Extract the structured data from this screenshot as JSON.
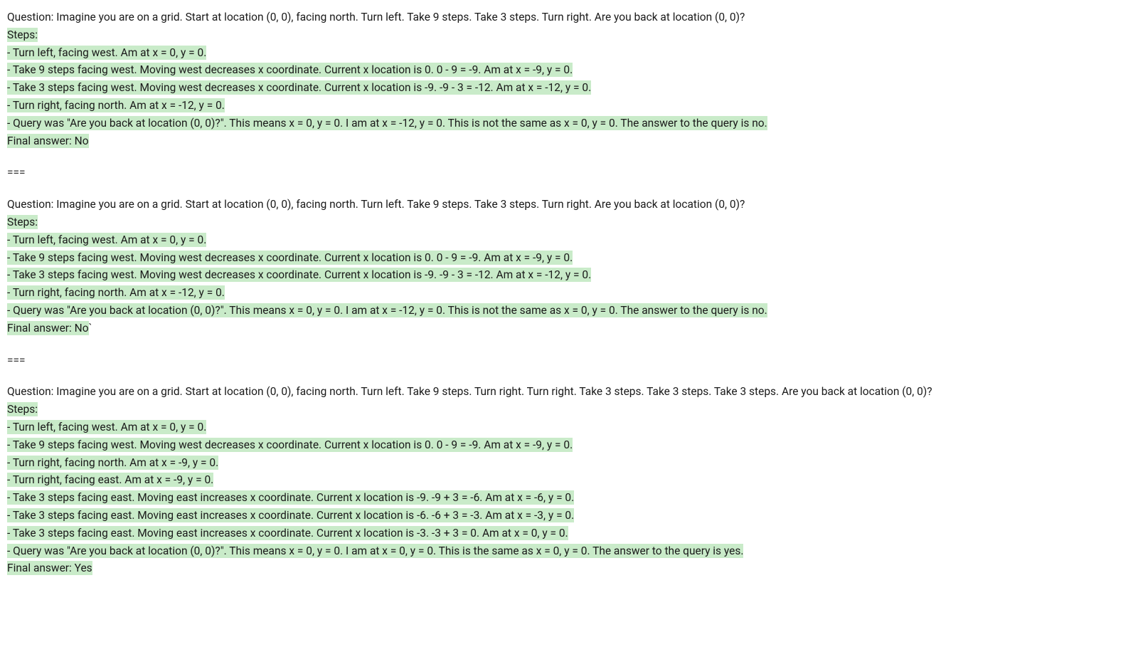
{
  "separator": "===",
  "examples": [
    {
      "question": "Question: Imagine you are on a grid. Start at location (0, 0), facing north. Turn left. Take 9 steps. Take 3 steps. Turn right. Are you back at location (0, 0)?",
      "steps_label": "Steps:",
      "steps": [
        "- Turn left, facing west. Am at x = 0, y = 0.",
        "- Take 9 steps facing west. Moving west decreases x coordinate. Current x location is 0. 0 - 9 = -9. Am at x = -9, y = 0.",
        "- Take 3 steps facing west. Moving west decreases x coordinate. Current x location is -9. -9 - 3 = -12. Am at x = -12, y = 0.",
        "- Turn right, facing north. Am at x = -12, y = 0.",
        "- Query was \"Are you back at location (0, 0)?\". This means x = 0, y = 0. I am at x = -12, y = 0. This is not the same as x = 0, y = 0. The answer to the query is no."
      ],
      "final_answer": "Final answer: No",
      "trailing": ""
    },
    {
      "question": "Question: Imagine you are on a grid. Start at location (0, 0), facing north. Turn left. Take 9 steps. Take 3 steps. Turn right. Are you back at location (0, 0)?",
      "steps_label": "Steps:",
      "steps": [
        "- Turn left, facing west. Am at x = 0, y = 0.",
        "- Take 9 steps facing west. Moving west decreases x coordinate. Current x location is 0. 0 - 9 = -9. Am at x = -9, y = 0.",
        "- Take 3 steps facing west. Moving west decreases x coordinate. Current x location is -9. -9 - 3 = -12. Am at x = -12, y = 0.",
        "- Turn right, facing north. Am at x = -12, y = 0.",
        "- Query was \"Are you back at location (0, 0)?\". This means x = 0, y = 0. I am at x = -12, y = 0. This is not the same as x = 0, y = 0. The answer to the query is no."
      ],
      "final_answer": "Final answer: No",
      "trailing": "`"
    },
    {
      "question": "Question: Imagine you are on a grid. Start at location (0, 0), facing north. Turn left. Take 9 steps. Turn right. Turn right. Take 3 steps. Take 3 steps. Take 3 steps. Are you back at location (0, 0)?",
      "steps_label": "Steps:",
      "steps": [
        "- Turn left, facing west. Am at x = 0, y = 0.",
        "- Take 9 steps facing west. Moving west decreases x coordinate. Current x location is 0. 0 - 9 = -9. Am at x = -9, y = 0.",
        "- Turn right, facing north. Am at x = -9, y = 0.",
        "- Turn right, facing east. Am at x = -9, y = 0.",
        "- Take 3 steps facing east. Moving east increases x coordinate. Current x location is -9. -9 + 3 = -6. Am at x = -6, y = 0.",
        "- Take 3 steps facing east. Moving east increases x coordinate. Current x location is -6. -6 + 3 = -3. Am at x = -3, y = 0.",
        "- Take 3 steps facing east. Moving east increases x coordinate. Current x location is -3. -3 + 3 = 0. Am at x = 0, y = 0.",
        "- Query was \"Are you back at location (0, 0)?\". This means x = 0, y = 0. I am at x = 0, y = 0. This is the same as x = 0, y = 0. The answer to the query is yes."
      ],
      "final_answer": "Final answer: Yes",
      "trailing": ""
    }
  ]
}
